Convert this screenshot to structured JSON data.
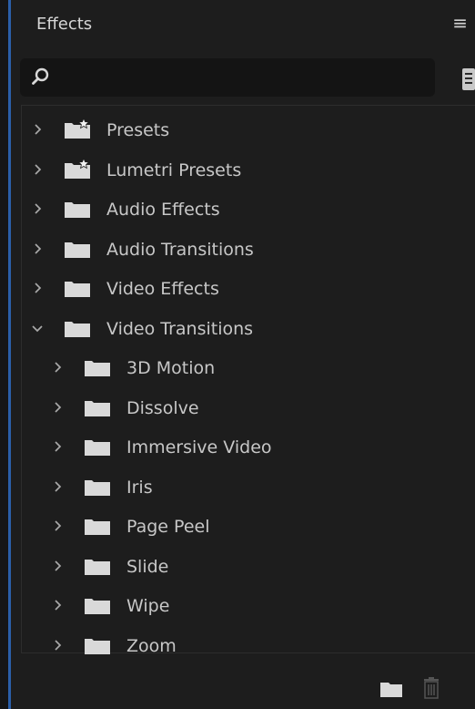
{
  "panel": {
    "title": "Effects",
    "menu_icon": "hamburger-menu-icon",
    "search_placeholder": ""
  },
  "tree": [
    {
      "label": "Presets",
      "expanded": false,
      "level": 0,
      "icon": "preset-folder-icon"
    },
    {
      "label": "Lumetri Presets",
      "expanded": false,
      "level": 0,
      "icon": "preset-folder-icon"
    },
    {
      "label": "Audio Effects",
      "expanded": false,
      "level": 0,
      "icon": "folder-icon"
    },
    {
      "label": "Audio Transitions",
      "expanded": false,
      "level": 0,
      "icon": "folder-icon"
    },
    {
      "label": "Video Effects",
      "expanded": false,
      "level": 0,
      "icon": "folder-icon"
    },
    {
      "label": "Video Transitions",
      "expanded": true,
      "level": 0,
      "icon": "folder-icon"
    },
    {
      "label": "3D Motion",
      "expanded": false,
      "level": 1,
      "icon": "folder-icon"
    },
    {
      "label": "Dissolve",
      "expanded": false,
      "level": 1,
      "icon": "folder-icon"
    },
    {
      "label": "Immersive Video",
      "expanded": false,
      "level": 1,
      "icon": "folder-icon"
    },
    {
      "label": "Iris",
      "expanded": false,
      "level": 1,
      "icon": "folder-icon"
    },
    {
      "label": "Page Peel",
      "expanded": false,
      "level": 1,
      "icon": "folder-icon"
    },
    {
      "label": "Slide",
      "expanded": false,
      "level": 1,
      "icon": "folder-icon"
    },
    {
      "label": "Wipe",
      "expanded": false,
      "level": 1,
      "icon": "folder-icon"
    },
    {
      "label": "Zoom",
      "expanded": false,
      "level": 1,
      "icon": "folder-icon"
    }
  ],
  "footer": {
    "new_bin_icon": "new-bin-icon",
    "delete_icon": "trash-icon"
  },
  "colors": {
    "panel_bg": "#1d1d1d",
    "search_bg": "#141414",
    "text": "#c7c7c7",
    "folder": "#d9d9d9",
    "accent_edge": "#2b5fa9"
  }
}
